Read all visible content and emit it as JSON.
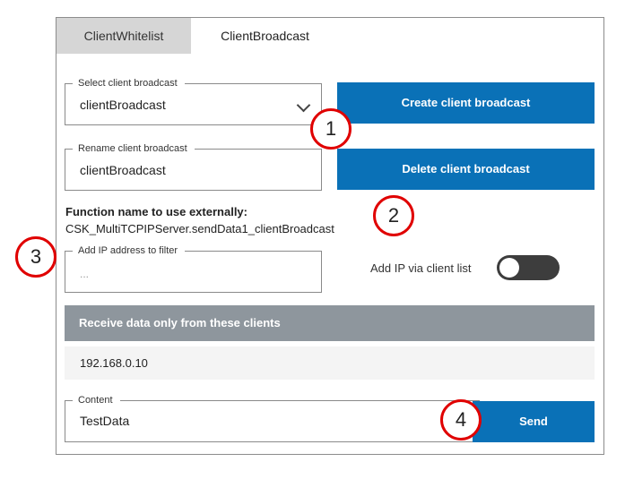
{
  "tabs": [
    {
      "label": "ClientWhitelist",
      "active": false
    },
    {
      "label": "ClientBroadcast",
      "active": true
    }
  ],
  "select_broadcast": {
    "legend": "Select client broadcast",
    "value": "clientBroadcast"
  },
  "create_button": "Create client broadcast",
  "rename_broadcast": {
    "legend": "Rename client broadcast",
    "value": "clientBroadcast"
  },
  "delete_button": "Delete client broadcast",
  "function_name": {
    "label": "Function name to use externally:",
    "value": "CSK_MultiTCPIPServer.sendData1_clientBroadcast"
  },
  "ip_filter": {
    "legend": "Add IP address to filter",
    "placeholder": "..."
  },
  "add_ip_via_list": {
    "label": "Add IP via client list",
    "enabled": false
  },
  "receive_table": {
    "header": "Receive data only from these clients",
    "rows": [
      "192.168.0.10"
    ]
  },
  "content": {
    "legend": "Content",
    "value": "TestData"
  },
  "send_button": "Send",
  "callouts": [
    "1",
    "2",
    "3",
    "4"
  ],
  "colors": {
    "accent": "#0a71b7",
    "callout": "#e00000",
    "header_gray": "#8e969d"
  }
}
